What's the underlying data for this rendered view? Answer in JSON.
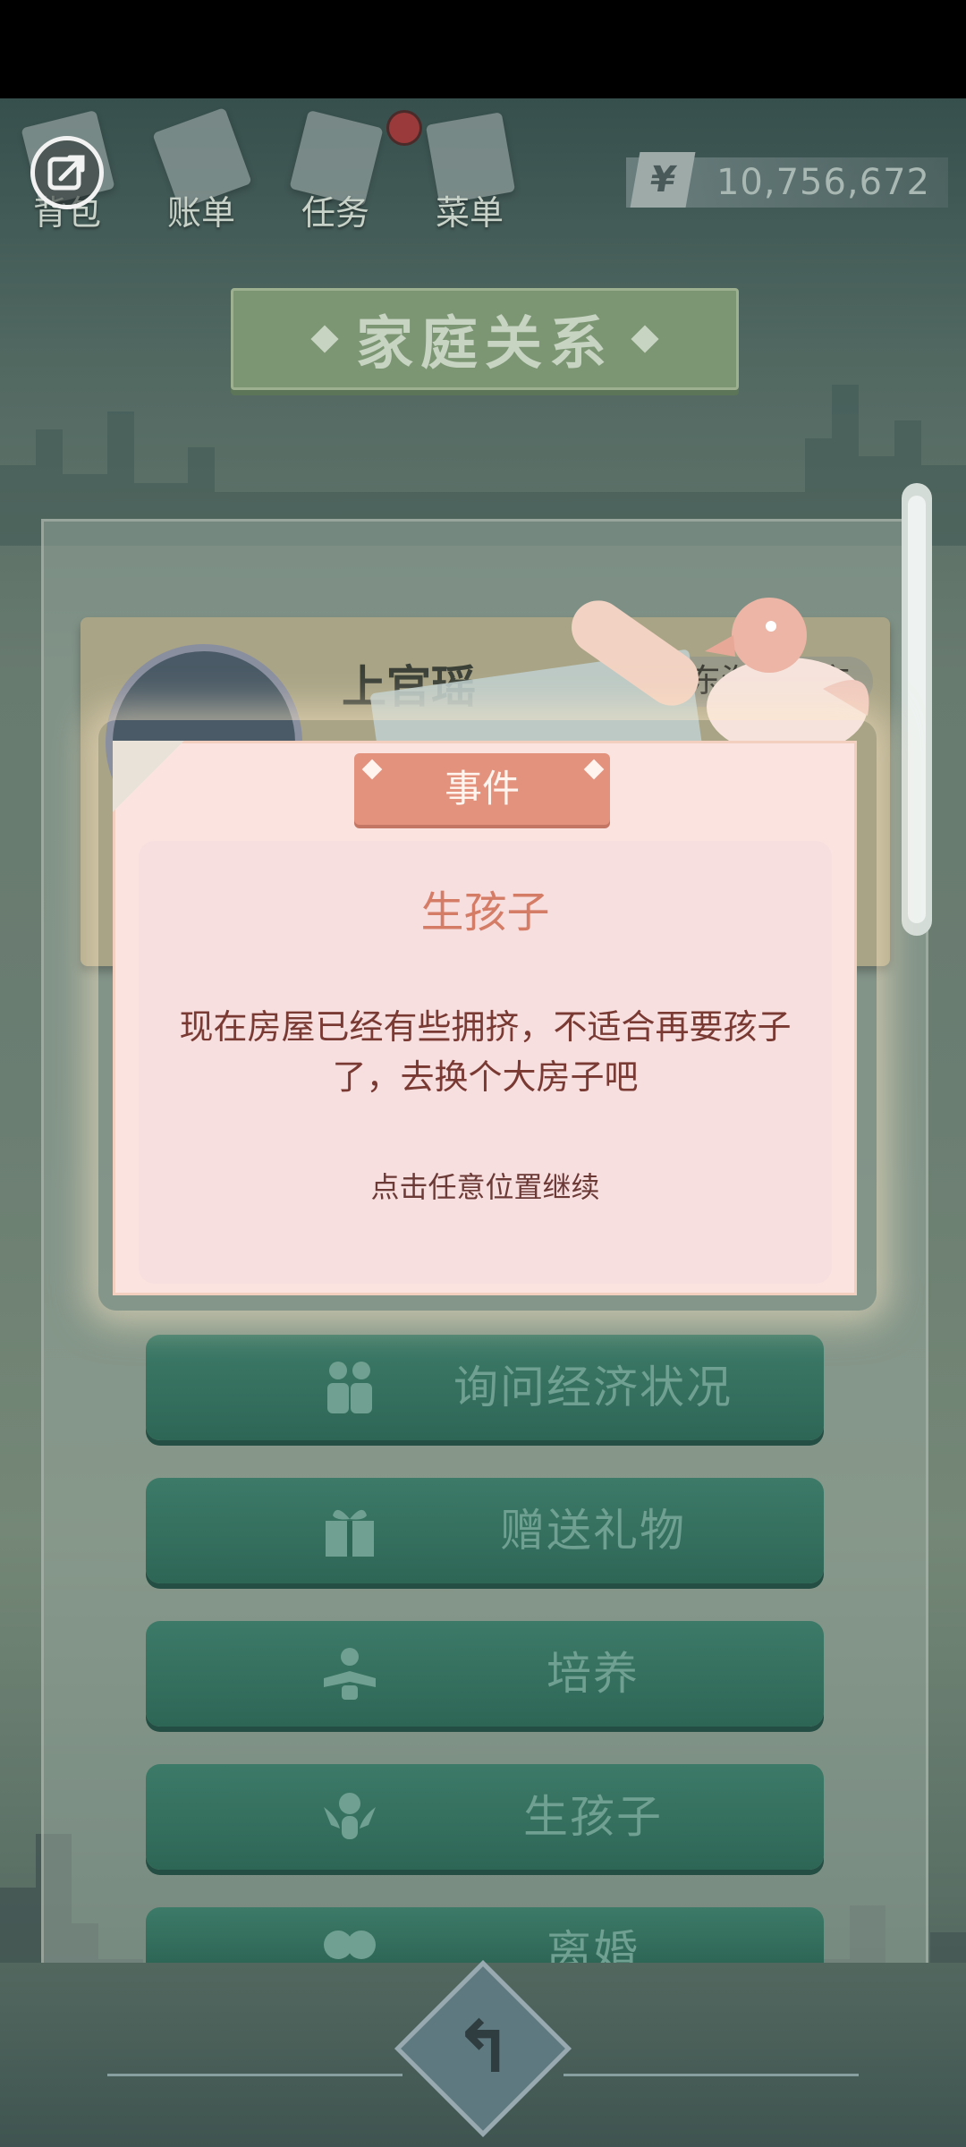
{
  "top_nav": {
    "items": [
      {
        "label": "背包",
        "icon": "backpack-icon"
      },
      {
        "label": "账单",
        "icon": "bill-icon"
      },
      {
        "label": "任务",
        "icon": "task-icon"
      },
      {
        "label": "菜单",
        "icon": "menu-icon"
      }
    ],
    "has_notification_on": "任务",
    "share_icon": "share-export-icon"
  },
  "money": {
    "currency_symbol": "¥",
    "amount": "10,756,672"
  },
  "page_title": "家庭关系",
  "character_card": {
    "name": "上官瑶",
    "city": "东海明珠市"
  },
  "actions": [
    {
      "label": "询问经济状况",
      "icon": "couple-icon"
    },
    {
      "label": "赠送礼物",
      "icon": "gift-icon"
    },
    {
      "label": "培养",
      "icon": "reading-child-icon"
    },
    {
      "label": "生孩子",
      "icon": "baby-angel-icon"
    },
    {
      "label": "离婚",
      "icon": "broken-heart-icon"
    }
  ],
  "event_modal": {
    "tab_label": "事件",
    "title": "生孩子",
    "body": "现在房屋已经有些拥挤，不适合再要孩子了，去换个大房子吧",
    "hint": "点击任意位置继续"
  },
  "bottom": {
    "back_icon": "return-arrow-icon"
  },
  "colors": {
    "modal_bg": "#fbe4e0",
    "tab": "#e3927e",
    "title_text": "#d57c66",
    "action_button": "#2e6656"
  }
}
